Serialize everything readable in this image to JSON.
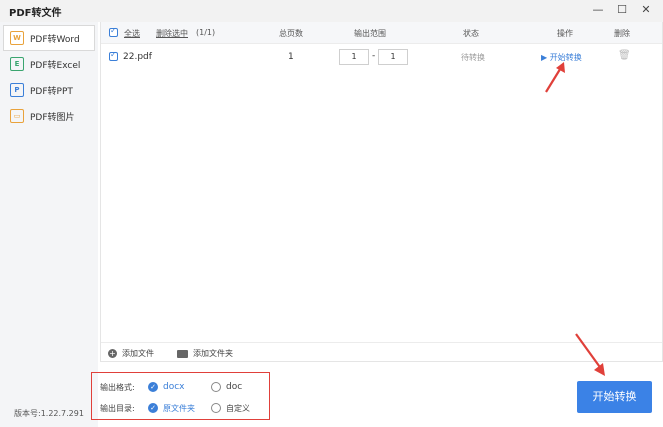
{
  "window": {
    "title": "PDF转文件",
    "controls": {
      "minimize": "—",
      "maximize": "☐",
      "close": "✕"
    }
  },
  "sidebar": {
    "items": [
      {
        "icon_text": "W",
        "label": "PDF转Word",
        "active": true
      },
      {
        "icon_text": "E",
        "label": "PDF转Excel",
        "active": false
      },
      {
        "icon_text": "P",
        "label": "PDF转PPT",
        "active": false
      },
      {
        "icon_text": "▭",
        "label": "PDF转图片",
        "active": false
      }
    ],
    "version": "版本号:1.22.7.291"
  },
  "table": {
    "select_all": "全选",
    "delete_selected": "删除选中",
    "selection_count": "(1/1)",
    "columns": {
      "total_pages": "总页数",
      "output_range": "输出范围",
      "status": "状态",
      "operation": "操作",
      "delete": "删除"
    },
    "rows": [
      {
        "name": "22.pdf",
        "pages": "1",
        "range_from": "1",
        "range_sep": "-",
        "range_to": "1",
        "status": "待转换",
        "action": "开始转换"
      }
    ],
    "add_file": "添加文件",
    "add_folder": "添加文件夹"
  },
  "options": {
    "format_label": "输出格式:",
    "format_selected": "docx",
    "format_other": "doc",
    "dir_label": "输出目录:",
    "dir_selected": "原文件夹",
    "dir_other": "自定义"
  },
  "convert_button": "开始转换",
  "colors": {
    "accent": "#3b82e6",
    "highlight_border": "#e0403a"
  }
}
